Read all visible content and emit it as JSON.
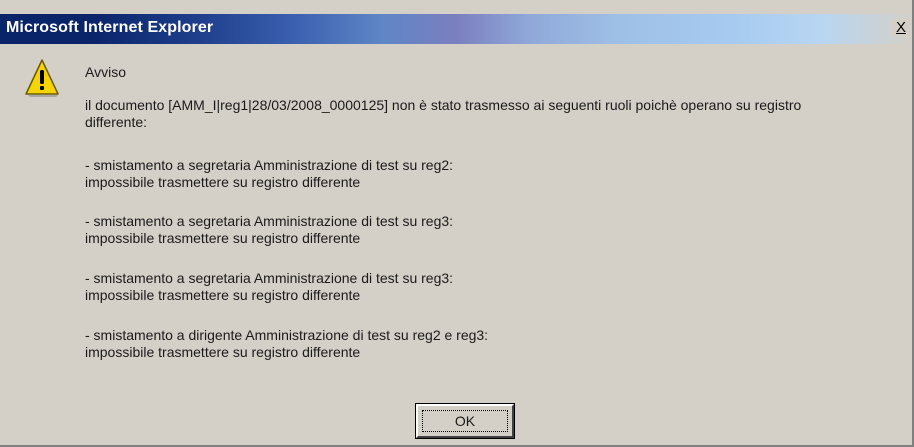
{
  "window": {
    "title": "Microsoft Internet Explorer",
    "close_label": "X"
  },
  "icon": {
    "name": "warning-icon",
    "color": "#f5d400"
  },
  "message": {
    "heading": "Avviso",
    "intro": "il documento [AMM_I|reg1|28/03/2008_0000125] non è stato trasmesso ai seguenti ruoli poichè operano su registro\ndifferente:",
    "items": [
      " - smistamento a segretaria Amministrazione di test su reg2:\nimpossibile trasmettere su registro differente",
      " - smistamento a segretaria Amministrazione di test su reg3:\nimpossibile trasmettere su registro differente",
      " - smistamento a segretaria Amministrazione di test su reg3:\nimpossibile trasmettere su registro differente",
      " - smistamento a dirigente Amministrazione di test su reg2 e reg3:\nimpossibile trasmettere su registro differente"
    ]
  },
  "buttons": {
    "ok_label": "OK"
  },
  "colors": {
    "title_bar_start": "#0a246a",
    "title_bar_end": "#a6caf0",
    "dialog_background": "#d4d0c8"
  }
}
